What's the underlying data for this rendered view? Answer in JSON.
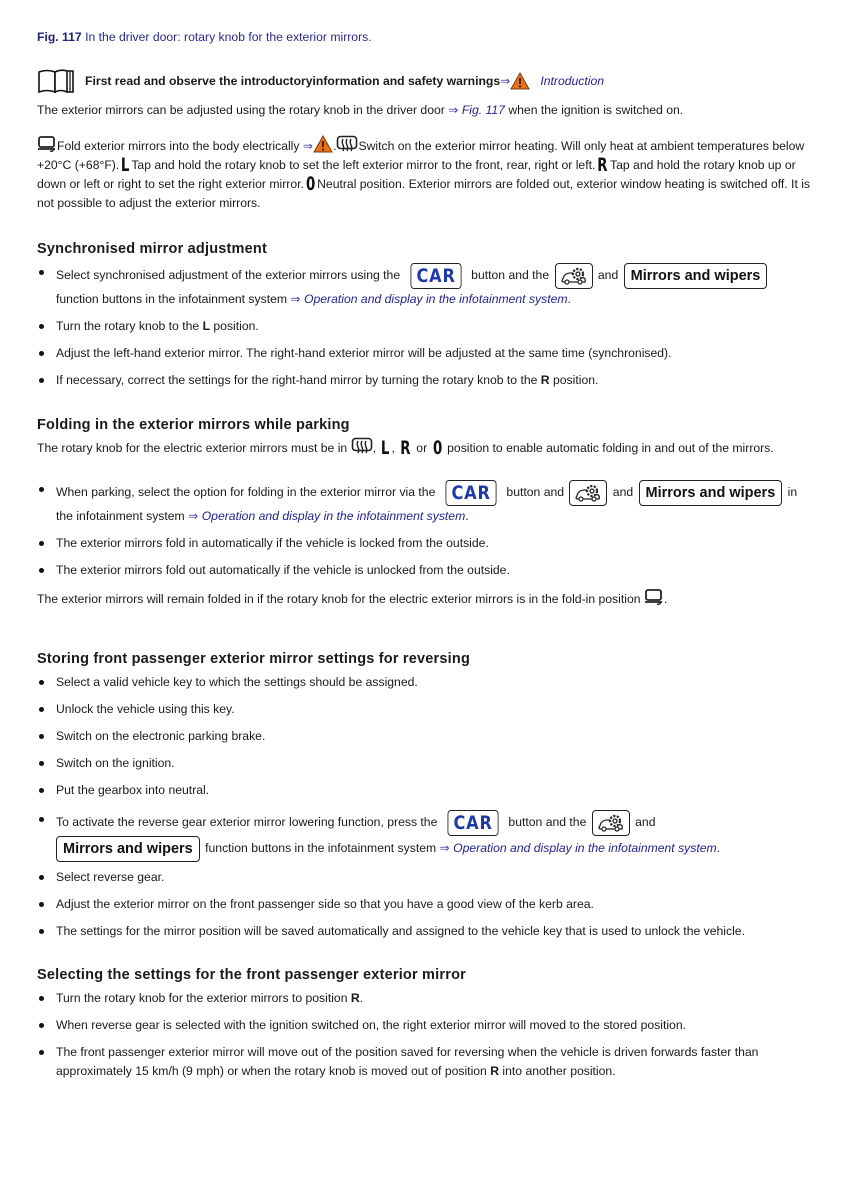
{
  "figure": {
    "label": "Fig. 117",
    "caption": "In the driver door: rotary knob for the exterior mirrors."
  },
  "intro": {
    "title": "First read and observe the introductoryinformation and safety warnings",
    "arrow": "⇒",
    "link": "Introduction"
  },
  "intro_paragraph": {
    "before": "The exterior mirrors can be adjusted using the rotary knob in the driver door ",
    "arrow": "⇒",
    "link": "Fig. 117",
    "after": " when the ignition is switched on."
  },
  "legend": {
    "fold_text": "Fold exterior mirrors into the body electrically ",
    "arrow": "⇒",
    "sep": ".",
    "heat_text": "Switch on the exterior mirror heating. Will only heat at ambient temperatures below +20°C (+68°F).",
    "L_glyph": "L",
    "L_text": "Tap and hold the rotary knob to set the left exterior mirror to the front, rear, right or left.",
    "R_glyph": "R",
    "R_text": "Tap and hold the rotary knob up or down or left or right to set the right exterior mirror.",
    "O_glyph": "0",
    "O_text": "Neutral position. Exterior mirrors are folded out, exterior window heating is switched off. It is not possible to adjust the exterior mirrors."
  },
  "buttons": {
    "car": "CAR",
    "mirrors": "Mirrors and wipers"
  },
  "link_operation": "Operation and display in the infotainment system",
  "arrow": "⇒",
  "sections": {
    "sync": {
      "heading": "Synchronised mirror adjustment",
      "b1_a": "Select synchronised adjustment of the exterior mirrors using the ",
      "b1_b": " button and the ",
      "b1_c": " and ",
      "b1_d": "function buttons in the infotainment system ",
      "b1_end": ".",
      "b2_a": "Turn the rotary knob to the ",
      "b2_bold": "L",
      "b2_b": " position.",
      "b3": "Adjust the left-hand exterior mirror. The right-hand exterior mirror will be adjusted at the same time (synchronised).",
      "b4_a": "If necessary, correct the settings for the right-hand mirror by turning the rotary knob to the ",
      "b4_bold": "R",
      "b4_b": " position."
    },
    "folding": {
      "heading": "Folding in the exterior mirrors while parking",
      "intro_a": "The rotary knob for the electric exterior mirrors must be in ",
      "intro_c1": ", ",
      "intro_c2": ", ",
      "intro_or": " or ",
      "intro_b": " position to enable automatic folding in and out of the mirrors.",
      "b1_a": "When parking, select the option for folding in the exterior mirror via the ",
      "b1_b": " button and ",
      "b1_c": " and ",
      "b1_d": " in the infotainment system ",
      "b1_end": ".",
      "b2": "The exterior mirrors fold in automatically if the vehicle is locked from the outside.",
      "b3": "The exterior mirrors fold out automatically if the vehicle is unlocked from the outside.",
      "outro": "The exterior mirrors will remain folded in if the rotary knob for the electric exterior mirrors is in the fold-in position ",
      "outro_end": "."
    },
    "storing": {
      "heading": "Storing front passenger exterior mirror settings for reversing",
      "b1": "Select a valid vehicle key to which the settings should be assigned.",
      "b2": "Unlock the vehicle using this key.",
      "b3": "Switch on the electronic parking brake.",
      "b4": "Switch on the ignition.",
      "b5": "Put the gearbox into neutral.",
      "b6_a": "To activate the reverse gear exterior mirror lowering function, press the ",
      "b6_b": " button and the ",
      "b6_c": " and",
      "b6_d": " function buttons in the infotainment system ",
      "b6_end": ".",
      "b7": "Select reverse gear.",
      "b8": "Adjust the exterior mirror on the front passenger side so that you have a good view of the kerb area.",
      "b9": "The settings for the mirror position will be saved automatically and assigned to the vehicle key that is used to unlock the vehicle."
    },
    "selecting": {
      "heading": "Selecting the settings for the front passenger exterior mirror",
      "b1_a": "Turn the rotary knob for the exterior mirrors to position ",
      "b1_bold": "R",
      "b1_b": ".",
      "b2": "When reverse gear is selected with the ignition switched on, the right exterior mirror will moved to the stored position.",
      "b3_a": "The front passenger exterior mirror will move out of the position saved for reversing when the vehicle is driven forwards faster than approximately 15 km/h (9 mph) or when the rotary knob is moved out of position ",
      "b3_bold": "R",
      "b3_b": " into another position."
    }
  },
  "colors": {
    "link": "#23238e",
    "car_button_text": "#1e3aa8",
    "warning_orange": "#e8731a"
  }
}
